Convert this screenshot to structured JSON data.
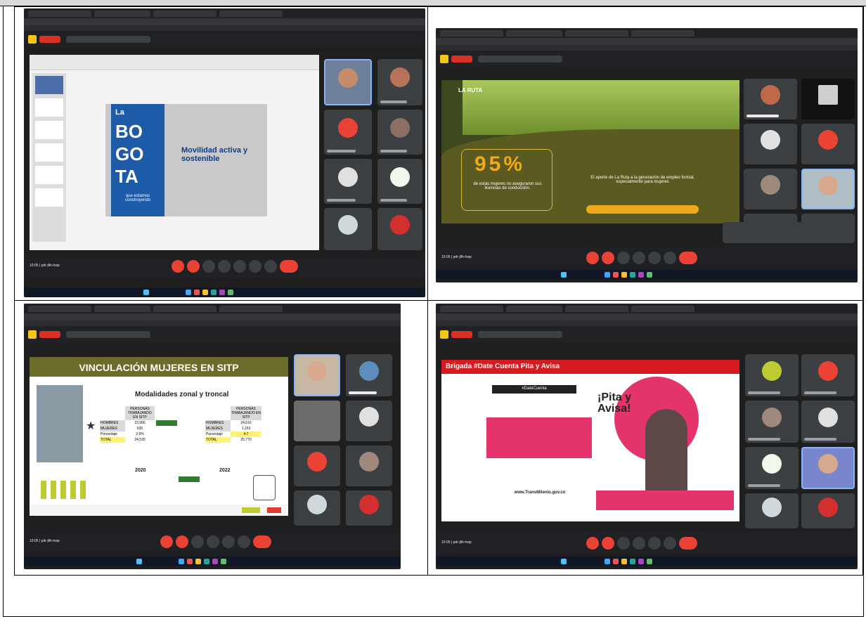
{
  "document": {
    "rows": [
      {
        "cells": [
          {
            "name": "Meet screenshot 1",
            "slide": {
              "brand_letters": [
                "La",
                "BO",
                "GO",
                "TA"
              ],
              "tagline": "que estamos construyendo",
              "title": "Movilidad activa y sostenible"
            }
          },
          {
            "name": "Meet screenshot 2",
            "slide": {
              "brand": "LA RUTA",
              "stat": "95%",
              "left_text": "de estas mujeres no aseguraron sus licencias de conducción.",
              "right_text": "El aporte de La Ruta a la generación de empleo formal, especialmente para mujeres"
            }
          }
        ]
      },
      {
        "cells": [
          {
            "name": "Meet screenshot 3",
            "slide": {
              "title": "VINCULACIÓN MUJERES EN SITP",
              "subtitle": "Modalidades zonal y troncal",
              "table_left": [
                [
                  "",
                  "PERSONAS TRABAJANDO EN SITP"
                ],
                [
                  "HOMBRES",
                  "23,900"
                ],
                [
                  "MUJERES",
                  "635"
                ],
                [
                  "Porcentaje",
                  "2.6%"
                ],
                [
                  "TOTAL",
                  "24,535"
                ]
              ],
              "table_right": [
                [
                  "",
                  "PERSONAS TRABAJANDO EN SITP"
                ],
                [
                  "HOMBRES",
                  "24,616"
                ],
                [
                  "MUJERES",
                  "1,153"
                ],
                [
                  "Porcentaje",
                  "4.7"
                ],
                [
                  "TOTAL",
                  "25,770"
                ]
              ],
              "year_left": "2020",
              "year_right": "2022"
            }
          },
          {
            "name": "Meet screenshot 4",
            "slide": {
              "title": "Brigada #Date Cuenta Pita y Avisa",
              "hashtag": "#DateCuenta",
              "headline": "¡Pita y Avisa!",
              "url": "www.TransMilenio.gov.co"
            }
          }
        ]
      }
    ],
    "meeting": {
      "time_label": "10:05 | pdr-jfih-hwp"
    },
    "colors": {
      "meet_bg": "#202124",
      "tile_bg": "#3c4043",
      "danger": "#ea4335",
      "bogota_blue": "#1d5aa8",
      "ruta_green": "#8cc63f",
      "sitp_olive": "#6b6b2a",
      "pita_pink": "#e4346b",
      "header_red": "#d71920"
    }
  }
}
